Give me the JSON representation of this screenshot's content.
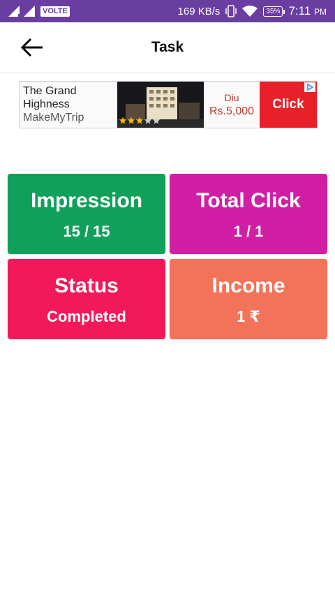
{
  "status_bar": {
    "network_badge": "VOLTE",
    "speed": "169 KB/s",
    "battery": "35%",
    "time": "7:11",
    "ampm": "PM"
  },
  "header": {
    "title": "Task",
    "back_icon": "arrow-left-icon"
  },
  "ad": {
    "line1": "The Grand",
    "line2": "Highness",
    "brand": "MakeMyTrip",
    "location": "Diu",
    "price": "Rs.5,000",
    "cta": "Click",
    "rating_stars": 3
  },
  "stats": [
    {
      "label": "Impression",
      "value": "15 / 15",
      "color": "#10a05a"
    },
    {
      "label": "Total Click",
      "value": "1 / 1",
      "color": "#d11fa5"
    },
    {
      "label": "Status",
      "value": "Completed",
      "color": "#f2195a"
    },
    {
      "label": "Income",
      "value": "1 ₹",
      "color": "#f2735a"
    }
  ]
}
